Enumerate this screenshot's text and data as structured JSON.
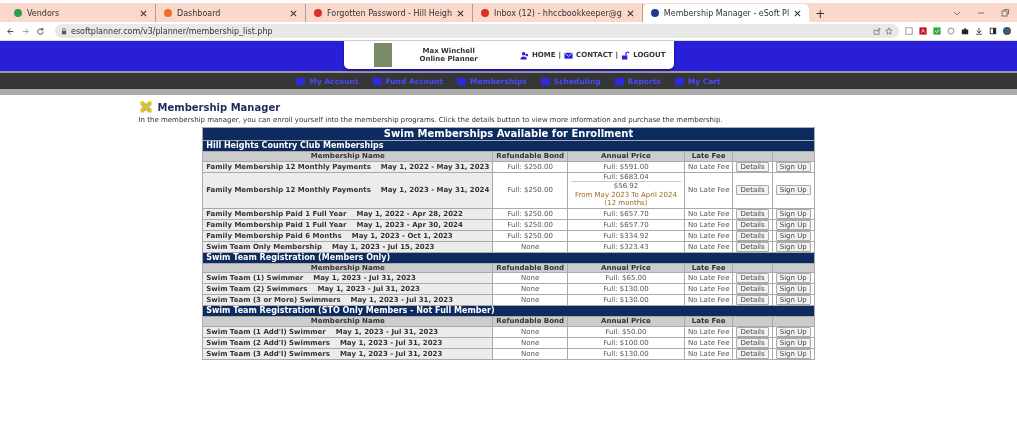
{
  "browser": {
    "tabs": [
      {
        "title": "Vendors",
        "selected": false,
        "color": "#2e9e4f"
      },
      {
        "title": "Dashboard",
        "selected": false,
        "color": "#e8702a"
      },
      {
        "title": "Forgotten Password - Hill Heigh",
        "selected": false,
        "color": "#d93025"
      },
      {
        "title": "Inbox (12) - hhccbookkeeper@g",
        "selected": false,
        "color": "#d93025"
      },
      {
        "title": "Membership Manager - eSoft Pl",
        "selected": true,
        "color": "#1f3b8c"
      }
    ],
    "new_tab": "+",
    "address": "esoftplanner.com/v3/planner/membership_list.php"
  },
  "header": {
    "user_name": "Max Winchell",
    "subtitle": "Online Planner",
    "links": [
      {
        "label": "HOME",
        "kind": "home"
      },
      {
        "label": "CONTACT",
        "kind": "contact"
      },
      {
        "label": "LOGOUT",
        "kind": "logout"
      }
    ],
    "separator": "|"
  },
  "nav": [
    "My Account",
    "Fund Account",
    "Memberships",
    "Scheduling",
    "Reports",
    "My Cart"
  ],
  "page": {
    "title": "Membership Manager",
    "intro": "In the membership manager, you can enroll yourself into the membership programs. Click the details button to view more information and purchase the membership."
  },
  "table": {
    "title": "Swim Memberships Available for Enrollment",
    "sections": [
      {
        "title": "Hill Heights Country Club Memberships",
        "columns": [
          "Membership Name",
          "Refundable Bond",
          "Annual Price",
          "Late Fee"
        ],
        "rows": [
          {
            "name": "Family Membership 12 Monthly Payments",
            "dates": "May 1, 2022 - May 31, 2023",
            "bond": "Full: $250.00",
            "price": "Full: $591.00",
            "late_fee": "No Late Fee",
            "details": "Details",
            "signup": "Sign Up"
          },
          {
            "name": "Family Membership 12 Monthly Payments",
            "dates": "May 1, 2023 - May 31, 2024",
            "bond": "Full: $250.00",
            "price": "Full: $683.04",
            "installment": {
              "amount": "$56.92",
              "period": "From May 2023 To April 2024 (12 months)"
            },
            "late_fee": "No Late Fee",
            "details": "Details",
            "signup": "Sign Up"
          },
          {
            "name": "Family Membership Paid 1 Full Year",
            "dates": "May 1, 2022 - Apr 28, 2022",
            "bond": "Full: $250.00",
            "price": "Full: $657.70",
            "late_fee": "No Late Fee",
            "details": "Details",
            "signup": "Sign Up"
          },
          {
            "name": "Family Membership Paid 1 Full Year",
            "dates": "May 1, 2023 - Apr 30, 2024",
            "bond": "Full: $250.00",
            "price": "Full: $657.70",
            "late_fee": "No Late Fee",
            "details": "Details",
            "signup": "Sign Up"
          },
          {
            "name": "Family Membership Paid 6 Months",
            "dates": "May 1, 2023 - Oct 1, 2023",
            "bond": "Full: $250.00",
            "price": "Full: $334.92",
            "late_fee": "No Late Fee",
            "details": "Details",
            "signup": "Sign Up"
          },
          {
            "name": "Swim Team Only Membership",
            "dates": "May 1, 2023 - Jul 15, 2023",
            "bond": "None",
            "price": "Full: $323.43",
            "late_fee": "No Late Fee",
            "details": "Details",
            "signup": "Sign Up"
          }
        ]
      },
      {
        "title": "Swim Team Registration (Members Only)",
        "columns": [
          "Membership Name",
          "Refundable Bond",
          "Annual Price",
          "Late Fee"
        ],
        "rows": [
          {
            "name": "Swim Team (1) Swimmer",
            "dates": "May 1, 2023 - Jul 31, 2023",
            "bond": "None",
            "price": "Full: $65.00",
            "late_fee": "No Late Fee",
            "details": "Details",
            "signup": "Sign Up"
          },
          {
            "name": "Swim Team (2) Swimmers",
            "dates": "May 1, 2023 - Jul 31, 2023",
            "bond": "None",
            "price": "Full: $130.00",
            "late_fee": "No Late Fee",
            "details": "Details",
            "signup": "Sign Up"
          },
          {
            "name": "Swim Team (3 or More) Swimmers",
            "dates": "May 1, 2023 - Jul 31, 2023",
            "bond": "None",
            "price": "Full: $130.00",
            "late_fee": "No Late Fee",
            "details": "Details",
            "signup": "Sign Up"
          }
        ]
      },
      {
        "title": "Swim Team Registration (STO Only Members - Not Full Member)",
        "columns": [
          "Membership Name",
          "Refundable Bond",
          "Annual Price",
          "Late Fee"
        ],
        "rows": [
          {
            "name": "Swim Team (1 Add'l) Swimmer",
            "dates": "May 1, 2023 - Jul 31, 2023",
            "bond": "None",
            "price": "Full: $50.00",
            "late_fee": "No Late Fee",
            "details": "Details",
            "signup": "Sign Up"
          },
          {
            "name": "Swim Team (2 Add'l) Swimmers",
            "dates": "May 1, 2023 - Jul 31, 2023",
            "bond": "None",
            "price": "Full: $100.00",
            "late_fee": "No Late Fee",
            "details": "Details",
            "signup": "Sign Up"
          },
          {
            "name": "Swim Team (3 Add'l) Swimmers",
            "dates": "May 1, 2023 - Jul 31, 2023",
            "bond": "None",
            "price": "Full: $130.00",
            "late_fee": "No Late Fee",
            "details": "Details",
            "signup": "Sign Up"
          }
        ]
      }
    ]
  }
}
